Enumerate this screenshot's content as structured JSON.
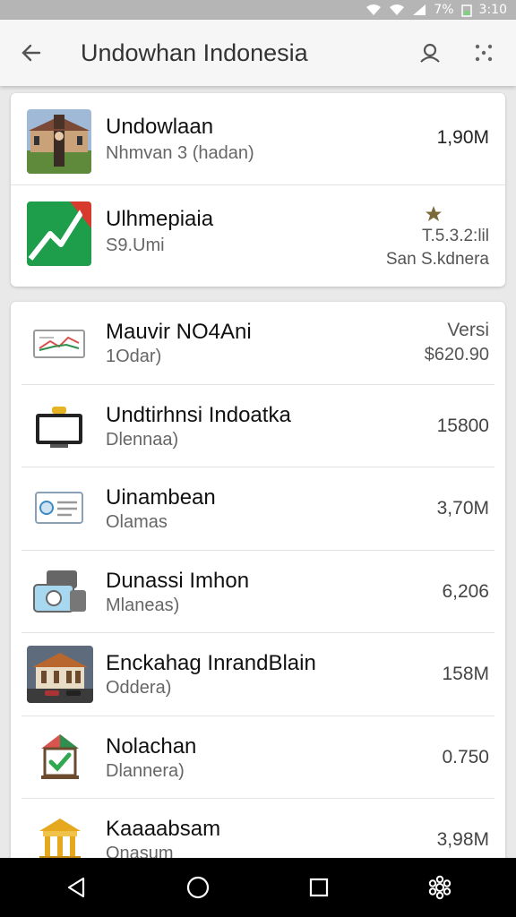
{
  "status": {
    "battery": "7%",
    "time": "3:10"
  },
  "appbar": {
    "title": "Undowhan Indonesia",
    "back_icon": "arrow-left-icon",
    "search_icon": "person-icon",
    "more_icon": "dots-icon"
  },
  "featured": [
    {
      "title": "Undowlaan",
      "subtitle": "Nhmvan 3 (hadan)",
      "value": "1,90M",
      "icon": "building-photo"
    },
    {
      "title": "Ulhmepiaia",
      "subtitle": "S9.Umi",
      "value": "T.5.3.2:lil",
      "value2": "San S.kdnera",
      "icon": "maps-logo",
      "star": "star-icon"
    }
  ],
  "list": [
    {
      "title": "Mauvir NO4Ani",
      "subtitle": "1Odar)",
      "value": "Versi",
      "value2": "$620.90",
      "icon": "chart-card-icon"
    },
    {
      "title": "Undtirhnsi Indoatka",
      "subtitle": "Dlennaa)",
      "value": "15800",
      "icon": "monitor-icon"
    },
    {
      "title": "Uinambean",
      "subtitle": "Olamas",
      "value": "3,70M",
      "icon": "id-card-icon"
    },
    {
      "title": "Dunassi Imhon",
      "subtitle": "Mlaneas)",
      "value": "6,206",
      "icon": "camera-icon"
    },
    {
      "title": "Enckahag InrandBlain",
      "subtitle": "Oddera)",
      "value": "158M",
      "icon": "palace-photo"
    },
    {
      "title": "Nolachan",
      "subtitle": "Dlannera)",
      "value": "0.750",
      "icon": "check-house-icon"
    },
    {
      "title": "Kaaaabsam",
      "subtitle": "Onasum",
      "value": "3,98M",
      "icon": "temple-icon"
    }
  ],
  "colors": {
    "status_bar": "#b5b5b5",
    "app_bar": "#f6f6f6",
    "background": "#e9e9e9",
    "nav_bar": "#000000"
  }
}
